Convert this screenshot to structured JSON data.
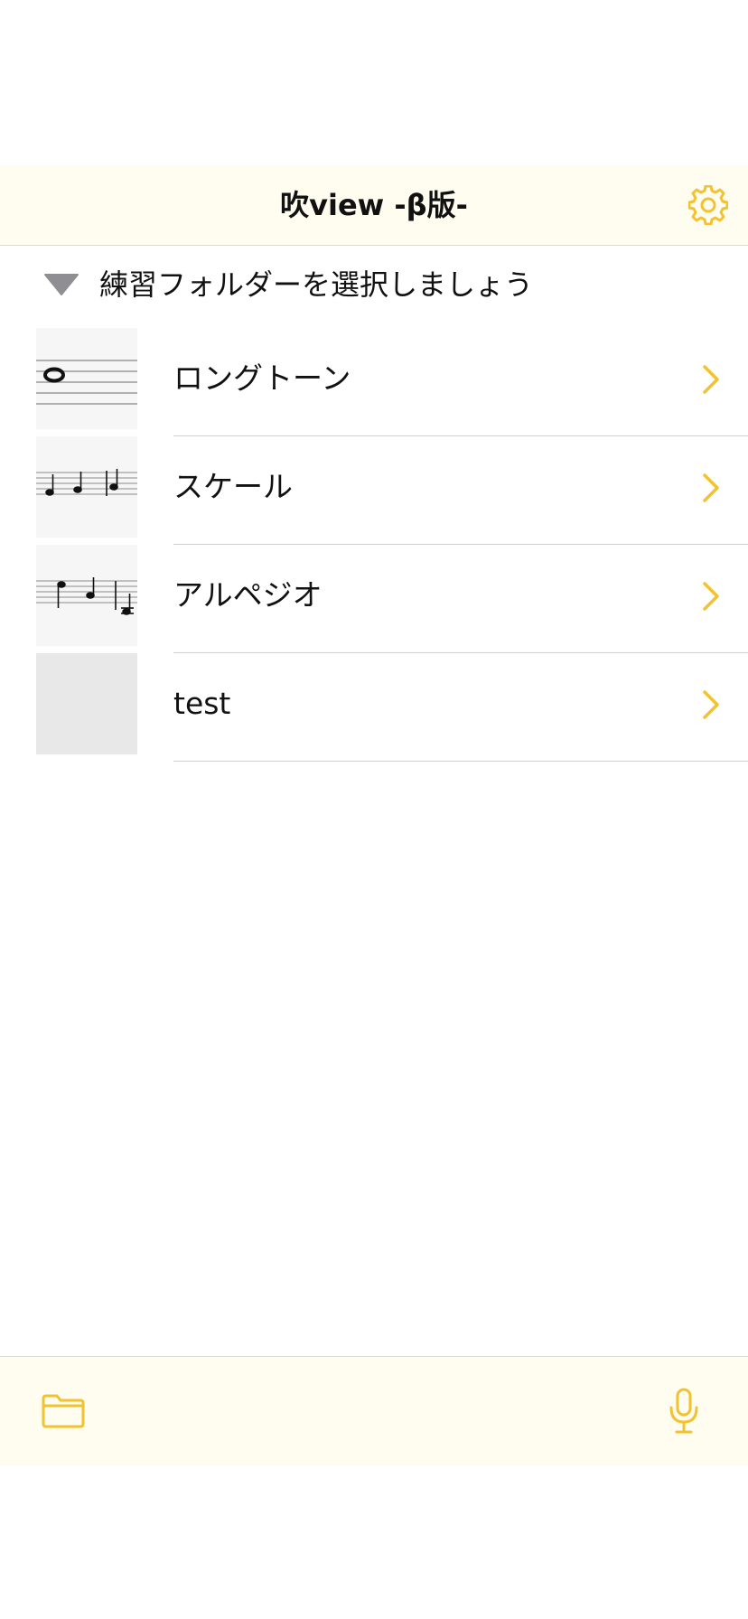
{
  "navbar": {
    "title": "吹view -β版-",
    "settings_icon": "gear-icon"
  },
  "section": {
    "title": "練習フォルダーを選択しましょう",
    "disclosure_icon": "triangle-down-icon"
  },
  "folders": [
    {
      "label": "ロングトーン",
      "thumbnail": "whole-note-staff"
    },
    {
      "label": "スケール",
      "thumbnail": "quarter-notes-staff"
    },
    {
      "label": "アルペジオ",
      "thumbnail": "arpeggio-notes-staff"
    },
    {
      "label": "test",
      "thumbnail": "empty"
    }
  ],
  "bottombar": {
    "left_icon": "folder-icon",
    "right_icon": "microphone-icon"
  },
  "colors": {
    "accent": "#f2c230",
    "bar_background": "#fffcf0",
    "disclosure": "#8e8e93",
    "separator": "#cfcfcf"
  }
}
